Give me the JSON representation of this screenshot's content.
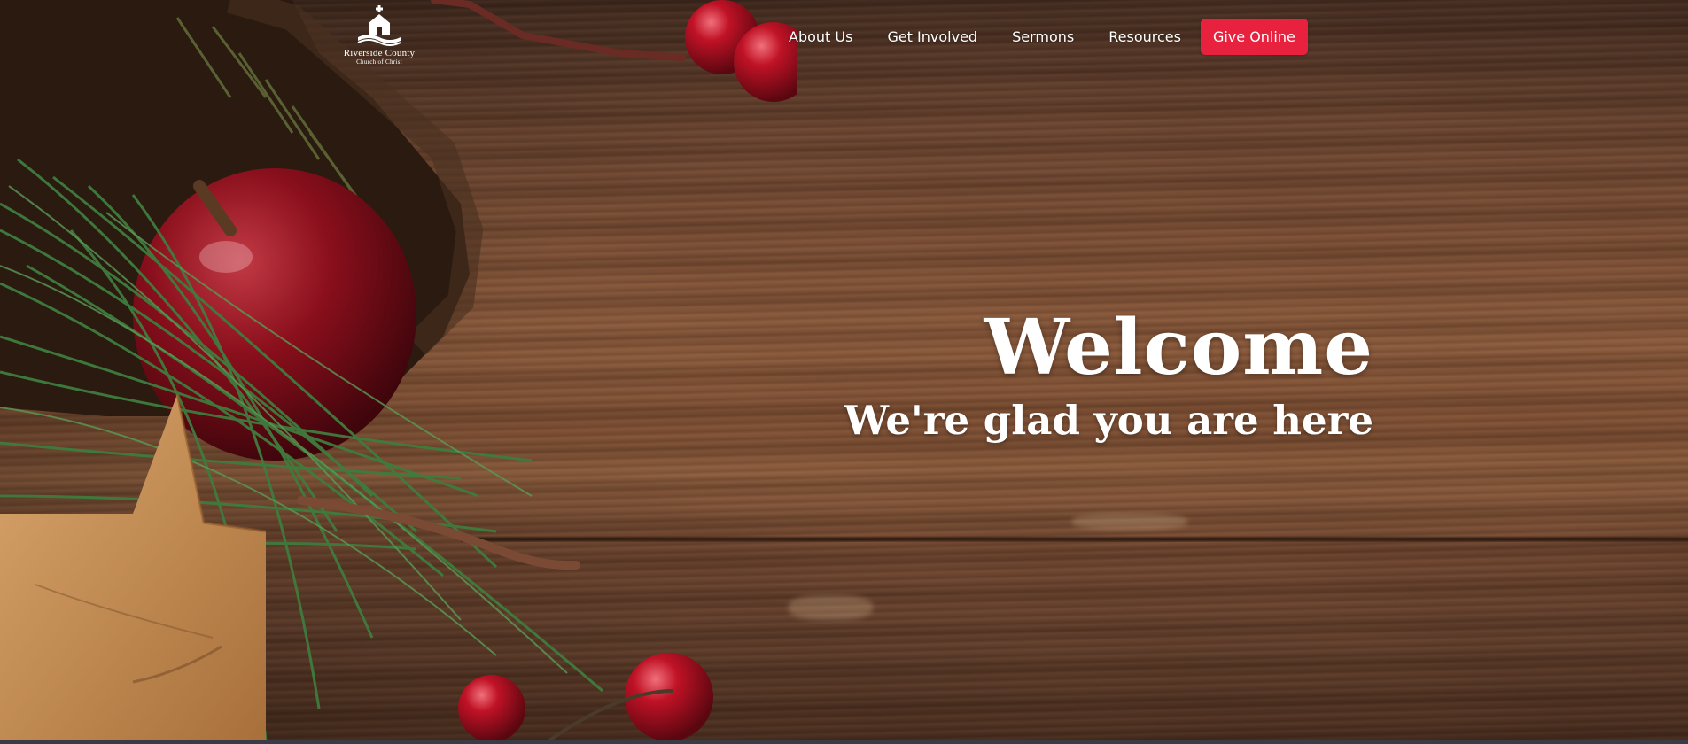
{
  "logo": {
    "line1": "Riverside County",
    "line2": "Church of Christ"
  },
  "nav": {
    "items": [
      {
        "label": "About Us"
      },
      {
        "label": "Get Involved"
      },
      {
        "label": "Sermons"
      },
      {
        "label": "Resources"
      }
    ],
    "give_button": "Give Online"
  },
  "hero": {
    "title": "Welcome",
    "subtitle": "We're glad you are here"
  },
  "colors": {
    "accent": "#e8213f",
    "text": "#ffffff"
  }
}
